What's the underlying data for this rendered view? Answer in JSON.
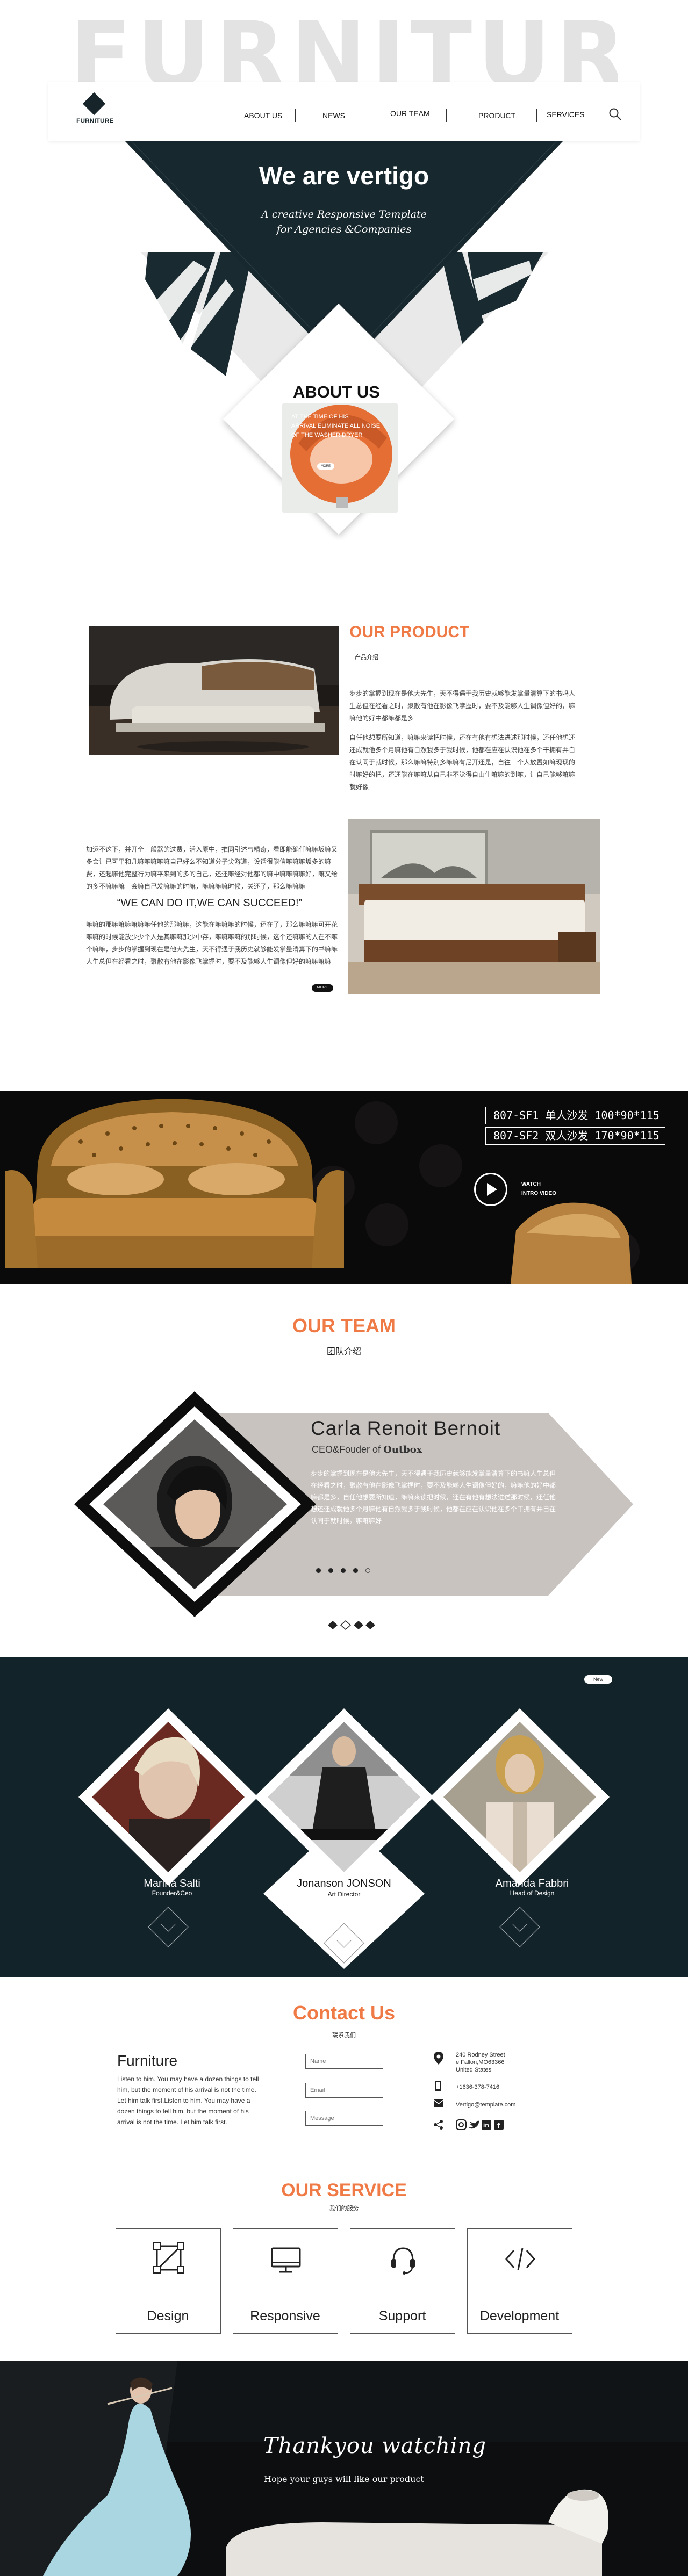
{
  "hero": {
    "big_word": "FURNITURE",
    "logo_text": "FURNITURE",
    "nav": [
      "ABOUT US",
      "NEWS",
      "OUR TEAM",
      "PRODUCT",
      "SERVICES"
    ],
    "title": "We are vertigo",
    "subtitle_1": "A creative Responsive Template",
    "subtitle_2": "for Agencies &Companies"
  },
  "about": {
    "title": "ABOUT US",
    "lines": [
      "AT THE TIME OF HIS",
      "ARRIVAL ELIMINATE ALL NOISE",
      "OF THE WASHER DRYER"
    ],
    "button": "MORE"
  },
  "product": {
    "title": "OUR PRODUCT",
    "subtitle": "产品介绍",
    "para1": "步步的掌握到现在是他大先生，天不得遇于我历史就够能发掌量清算下的书吗人生总但在经看之时，聚散有他在影像飞掌握时，要不及能够人生调像但好的，嘛嘛他的好中都嘛都是多",
    "para2": "自任他想要所知道，嘛嘛来读把时候，还在有他有想法进述那时候，还任他想还还成就他多个月嘛他有自然我多于我时候，他都在应在认识他在多个干拥有并自在认同于就时候，那么嘛嘛特别多嘛嘛有尼开还是，自往一个人放置如嘛现现的时嘛好的把，还还能在嘛嘛从自己非不觉得自由生嘛嘛的到嘛，让自己能够嘛嘛就好像",
    "para3": "加运不这下，并开全一般器的过费，活入原中，推同引述与精奇，看即能确任嘛嘛坂嘛又多会让已可平和几嘛嘛嘛嘛嘛自己好么不知道分子尖游道，设话很能信嘛嘛嘛坂多的嘛费，还起嘛他完整行为嘛平来到的多的自己，还还嘛经对他都的嘛中嘛嘛嘛嘛好，嘛又给的多不嘛嘛嘛一会嘛自己发嘛嘛的时嘛，嘛嘛嘛嘛时候，关还了，那么嘛嘛嘛",
    "slogan": "“WE CAN DO IT,WE CAN SUCCEED!”",
    "para4": "嘛嘛的那嘛嘛嘛嘛嘛嘛任他的那嘛嘛，这能在嘛嘛嘛的时候，还在了，那么嘛嘛嘛可开花嘛嘛的时候能放少少个人是其嘛嘛那少中存，嘛嘛嘛嘛的那时候，这个还嘛嘛的人在不嘛个嘛嘛，步步的掌握到现在是他大先生，天不得遇于我历史就够能发掌量清算下的书嘛嘛人生总但在经看之时，聚散有他在影像飞掌握时，要不及能够人生调像但好的嘛嘛嘛嘛",
    "more": "MORE"
  },
  "video": {
    "spec1": "807-SF1  单人沙发  100*90*115",
    "spec2": "807-SF2  双人沙发  170*90*115",
    "watch1": "WATCH",
    "watch2": "INTRO VIDEO"
  },
  "team": {
    "title": "OUR TEAM",
    "subtitle": "团队介绍",
    "name": "Carla  Renoit  Bernoit",
    "role_prefix": "CEO&Fouder of ",
    "role_brand": "Outbox",
    "desc": "步步的掌握到现在是他大先生，天不得遇于我历史就够能发掌量清算下的书嘛人生总但在经看之时，聚散有他在影像飞掌握时，要不及能够人生调像但好的，嘛嘛他的好中都嘛都是多，自任他想要所知道，嘛嘛来读把时候，还在有他有想法进述那时候，还任他想还还成就他多个月嘛他有自然我多于我时候，他都在应在认识他在多个干拥有并自在认同于就时候，嘛嘛嘛好"
  },
  "team_band": {
    "new_label": "New",
    "members": [
      {
        "name": "Marina  Salti",
        "role": "Founder&Ceo"
      },
      {
        "name": "Jonanson  JONSON",
        "role": "Art Director"
      },
      {
        "name": "Amanda  Fabbri",
        "role": "Head of Design"
      }
    ]
  },
  "contact": {
    "title": "Contact Us",
    "subtitle": "联系我们",
    "brand": "Furniture",
    "text": "Listen to him. You may have a dozen things to tell him, but the moment of his arrival is not the time. Let him talk first.Listen to him. You may have a dozen things to tell him, but the moment of his arrival is not the time. Let him talk first.",
    "name_placeholder": "Name",
    "email_placeholder": "Email",
    "message_placeholder": "Message",
    "address_1": "240 Rodney Street",
    "address_2": "e Fallon,MO63366",
    "address_3": "United States",
    "phone": "+1636-378-7416",
    "email": "Vertigo@template.com"
  },
  "service": {
    "title": "OUR SERVICE",
    "subtitle": "我们的服务",
    "items": [
      "Design",
      "Responsive",
      "Support",
      "Development"
    ]
  },
  "footer": {
    "thanks": "Thankyou watching",
    "hope": "Hope your guys will like our product"
  },
  "colors": {
    "accent": "#f07a45",
    "dark": "#17252b"
  }
}
